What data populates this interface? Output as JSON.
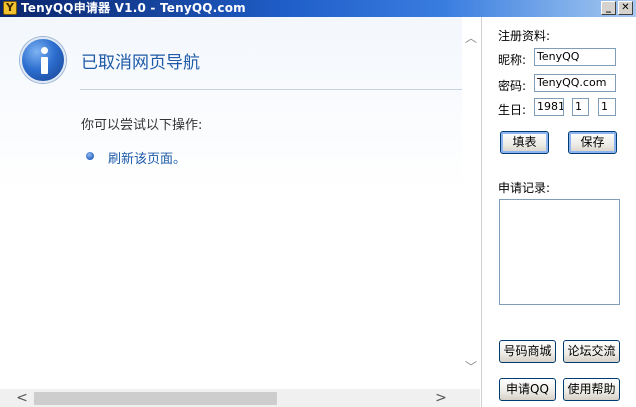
{
  "window": {
    "title": "TenyQQ申请器 V1.0 - TenyQQ.com",
    "app_icon_glyph": "Y",
    "minimize_glyph": "_",
    "close_glyph": "✕"
  },
  "browser": {
    "heading": "已取消网页导航",
    "try_text": "你可以尝试以下操作:",
    "refresh_link": "刷新该页面。",
    "scroll_up_glyph": "︿",
    "scroll_down_glyph": "﹀",
    "scroll_left_glyph": "<",
    "scroll_right_glyph": ">"
  },
  "panel": {
    "section_register": "注册资料:",
    "nickname_label": "昵称:",
    "nickname_value": "TenyQQ",
    "password_label": "密码:",
    "password_value": "TenyQQ.com",
    "birthday_label": "生日:",
    "birth_year": "1981",
    "birth_month": "1",
    "birth_day": "1",
    "fill_button": "填表",
    "save_button": "保存",
    "section_records": "申请记录:",
    "shop_button": "号码商城",
    "forum_button": "论坛交流",
    "apply_button": "申请QQ",
    "help_button": "使用帮助"
  },
  "colors": {
    "accent": "#1e5aa8",
    "titlebar_start": "#0a246a",
    "titlebar_end": "#a6caf0"
  },
  "icons": [
    "info-icon",
    "bullet-icon",
    "minimize-icon",
    "close-icon"
  ]
}
